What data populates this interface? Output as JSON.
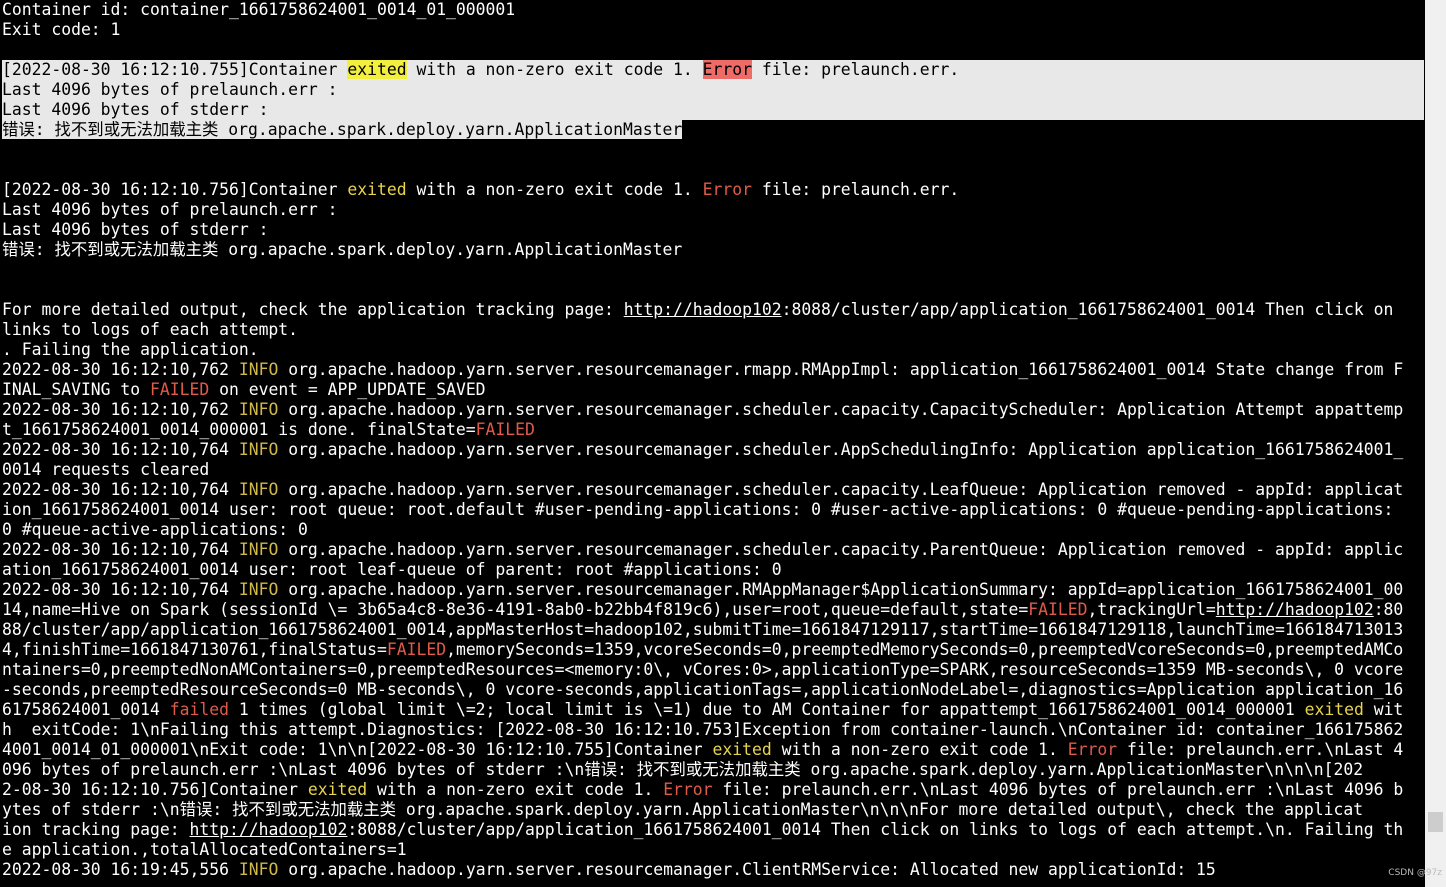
{
  "terminal": {
    "lines": [
      [
        {
          "t": "Container id: container_1661758624001_0014_01_000001"
        }
      ],
      [
        {
          "t": "Exit code: 1"
        }
      ],
      [],
      {
        "sel": true,
        "segs": [
          {
            "t": "[2022-08-30 16:12:10.755]"
          },
          {
            "t": "Container "
          },
          {
            "t": "exited",
            "c": "hl-yellow"
          },
          {
            "t": " with a non-zero exit code 1. "
          },
          {
            "t": "Error",
            "c": "hl-red"
          },
          {
            "t": " file: prelaunch.err."
          }
        ]
      },
      {
        "sel": true,
        "segs": [
          {
            "t": "Last 4096 bytes of prelaunch.err :"
          }
        ]
      },
      {
        "sel": true,
        "segs": [
          {
            "t": "Last 4096 bytes of stderr :"
          }
        ]
      },
      {
        "selPartial": true,
        "segs": [
          {
            "t": "错误: 找不到或无法加载主类 org.apache.spark.deploy.yarn.ApplicationMaster",
            "c": "sel-span"
          }
        ]
      },
      [],
      [],
      [
        {
          "t": "[2022-08-30 16:12:10.756]Container "
        },
        {
          "t": "exited",
          "c": "kw"
        },
        {
          "t": " with a non-zero exit code 1. "
        },
        {
          "t": "Error",
          "c": "err"
        },
        {
          "t": " file: prelaunch.err."
        }
      ],
      [
        {
          "t": "Last 4096 bytes of prelaunch.err :"
        }
      ],
      [
        {
          "t": "Last 4096 bytes of stderr :"
        }
      ],
      [
        {
          "t": "错误: 找不到或无法加载主类 org.apache.spark.deploy.yarn.ApplicationMaster"
        }
      ],
      [],
      [],
      [
        {
          "t": "For more detailed output, check the application tracking page: "
        },
        {
          "t": "http://hadoop102",
          "c": "link"
        },
        {
          "t": ":8088/cluster/app/application_1661758624001_0014 Then click on"
        }
      ],
      [
        {
          "t": "links to logs of each attempt."
        }
      ],
      [
        {
          "t": ". Failing the application."
        }
      ],
      [
        {
          "t": "2022-08-30 16:12:10,762 "
        },
        {
          "t": "INFO",
          "c": "info"
        },
        {
          "t": " org.apache.hadoop.yarn.server.resourcemanager.rmapp.RMAppImpl: application_1661758624001_0014 State change from F"
        }
      ],
      [
        {
          "t": "INAL_SAVING to "
        },
        {
          "t": "FAILED",
          "c": "err"
        },
        {
          "t": " on event = APP_UPDATE_SAVED"
        }
      ],
      [
        {
          "t": "2022-08-30 16:12:10,762 "
        },
        {
          "t": "INFO",
          "c": "info"
        },
        {
          "t": " org.apache.hadoop.yarn.server.resourcemanager.scheduler.capacity.CapacityScheduler: Application Attempt appattemp"
        }
      ],
      [
        {
          "t": "t_1661758624001_0014_000001 is done. finalState="
        },
        {
          "t": "FAILED",
          "c": "err"
        }
      ],
      [
        {
          "t": "2022-08-30 16:12:10,764 "
        },
        {
          "t": "INFO",
          "c": "info"
        },
        {
          "t": " org.apache.hadoop.yarn.server.resourcemanager.scheduler.AppSchedulingInfo: Application application_1661758624001_"
        }
      ],
      [
        {
          "t": "0014 requests cleared"
        }
      ],
      [
        {
          "t": "2022-08-30 16:12:10,764 "
        },
        {
          "t": "INFO",
          "c": "info"
        },
        {
          "t": " org.apache.hadoop.yarn.server.resourcemanager.scheduler.capacity.LeafQueue: Application removed - appId: applicat"
        }
      ],
      [
        {
          "t": "ion_1661758624001_0014 user: root queue: root.default #user-pending-applications: 0 #user-active-applications: 0 #queue-pending-applications:"
        }
      ],
      [
        {
          "t": "0 #queue-active-applications: 0"
        }
      ],
      [
        {
          "t": "2022-08-30 16:12:10,764 "
        },
        {
          "t": "INFO",
          "c": "info"
        },
        {
          "t": " org.apache.hadoop.yarn.server.resourcemanager.scheduler.capacity.ParentQueue: Application removed - appId: applic"
        }
      ],
      [
        {
          "t": "ation_1661758624001_0014 user: root leaf-queue of parent: root #applications: 0"
        }
      ],
      [
        {
          "t": "2022-08-30 16:12:10,764 "
        },
        {
          "t": "INFO",
          "c": "info"
        },
        {
          "t": " org.apache.hadoop.yarn.server.resourcemanager.RMAppManager$ApplicationSummary: appId=application_1661758624001_00"
        }
      ],
      [
        {
          "t": "14,name=Hive on Spark (sessionId \\= 3b65a4c8-8e36-4191-8ab0-b22bb4f819c6),user=root,queue=default,state="
        },
        {
          "t": "FAILED",
          "c": "err"
        },
        {
          "t": ",trackingUrl="
        },
        {
          "t": "http://hadoop102",
          "c": "link"
        },
        {
          "t": ":80"
        }
      ],
      [
        {
          "t": "88/cluster/app/application_1661758624001_0014,appMasterHost=hadoop102,submitTime=1661847129117,startTime=1661847129118,launchTime=166184713013"
        }
      ],
      [
        {
          "t": "4,finishTime=1661847130761,finalStatus="
        },
        {
          "t": "FAILED",
          "c": "err"
        },
        {
          "t": ",memorySeconds=1359,vcoreSeconds=0,preemptedMemorySeconds=0,preemptedVcoreSeconds=0,preemptedAMCo"
        }
      ],
      [
        {
          "t": "ntainers=0,preemptedNonAMContainers=0,preemptedResources=<memory:0\\, vCores:0>,applicationType=SPARK,resourceSeconds=1359 MB-seconds\\, 0 vcore"
        }
      ],
      [
        {
          "t": "-seconds,preemptedResourceSeconds=0 MB-seconds\\, 0 vcore-seconds,applicationTags=,applicationNodeLabel=,diagnostics=Application application_16"
        }
      ],
      [
        {
          "t": "61758624001_0014 "
        },
        {
          "t": "failed",
          "c": "err"
        },
        {
          "t": " 1 times (global limit \\=2; local limit is \\=1) due to AM Container for appattempt_1661758624001_0014_000001 "
        },
        {
          "t": "exited",
          "c": "kw"
        },
        {
          "t": " wit"
        }
      ],
      [
        {
          "t": "h  exitCode: 1\\nFailing this attempt.Diagnostics: [2022-08-30 16:12:10.753]Exception from container-launch.\\nContainer id: container_166175862"
        }
      ],
      [
        {
          "t": "4001_0014_01_000001\\nExit code: 1\\n\\n[2022-08-30 16:12:10.755]Container "
        },
        {
          "t": "exited",
          "c": "kw"
        },
        {
          "t": " with a non-zero exit code 1. "
        },
        {
          "t": "Error",
          "c": "err"
        },
        {
          "t": " file: prelaunch.err.\\nLast 4"
        }
      ],
      [
        {
          "t": "096 bytes of prelaunch.err :\\nLast 4096 bytes of stderr :\\n错误: 找不到或无法加载主类 org.apache.spark.deploy.yarn.ApplicationMaster\\n\\n\\n[202"
        }
      ],
      [
        {
          "t": "2-08-30 16:12:10.756]Container "
        },
        {
          "t": "exited",
          "c": "kw"
        },
        {
          "t": " with a non-zero exit code 1. "
        },
        {
          "t": "Error",
          "c": "err"
        },
        {
          "t": " file: prelaunch.err.\\nLast 4096 bytes of prelaunch.err :\\nLast 4096 b"
        }
      ],
      [
        {
          "t": "ytes of stderr :\\n错误: 找不到或无法加载主类 org.apache.spark.deploy.yarn.ApplicationMaster\\n\\n\\nFor more detailed output\\, check the applicat"
        }
      ],
      [
        {
          "t": "ion tracking page: "
        },
        {
          "t": "http://hadoop102",
          "c": "link"
        },
        {
          "t": ":8088/cluster/app/application_1661758624001_0014 Then click on links to logs of each attempt.\\n. Failing th"
        }
      ],
      [
        {
          "t": "e application.,totalAllocatedContainers=1"
        }
      ],
      [
        {
          "t": "2022-08-30 16:19:45,556 "
        },
        {
          "t": "INFO",
          "c": "info"
        },
        {
          "t": " org.apache.hadoop.yarn.server.resourcemanager.ClientRMService: Allocated new applicationId: 15"
        }
      ]
    ]
  },
  "watermark": "CSDN @97z",
  "colors": {
    "background": "#000000",
    "text": "#ffffff",
    "info": "#d0b94a",
    "keyword": "#e8d44d",
    "error": "#e05a4a",
    "selection": "#e8e8e8",
    "highlight_yellow": "#f3ef3f",
    "highlight_red": "#ef6b68"
  }
}
